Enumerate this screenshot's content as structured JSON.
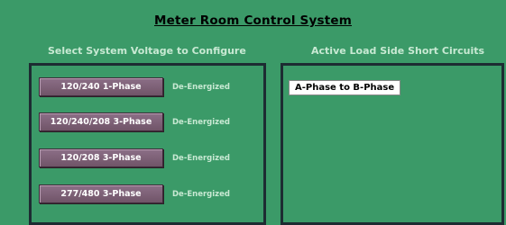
{
  "title": "Meter Room Control System",
  "left_section_label": "Select System Voltage to Configure",
  "right_section_label": "Active Load Side Short Circuits",
  "voltage_options": [
    {
      "label": "120/240 1-Phase",
      "status": "De-Energized"
    },
    {
      "label": "120/240/208 3-Phase",
      "status": "De-Energized"
    },
    {
      "label": "120/208 3-Phase",
      "status": "De-Energized"
    },
    {
      "label": "277/480 3-Phase",
      "status": "De-Energized"
    }
  ],
  "active_faults": [
    "A-Phase to B-Phase"
  ]
}
